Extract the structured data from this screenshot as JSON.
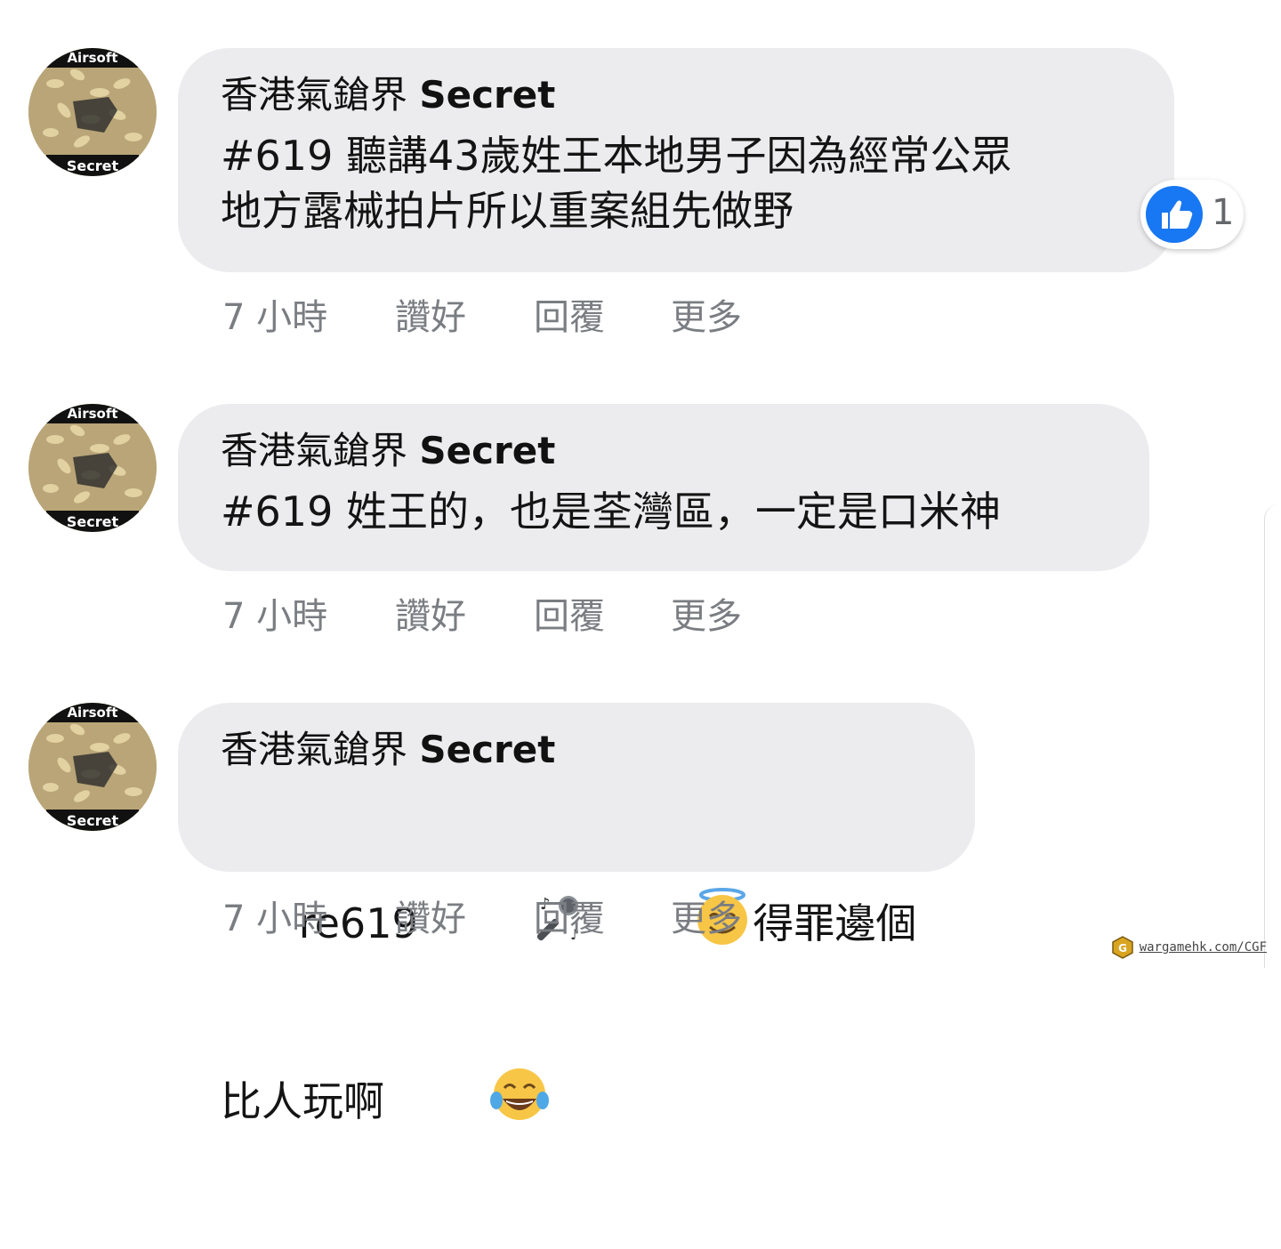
{
  "comments": [
    {
      "author_prefix": "香港氣鎗界",
      "author_bold": "Secret",
      "text": "#619 聽講43歲姓王本地男子因為經常公眾\n地方露械拍片所以重案組先做野",
      "time": "7 小時",
      "like": "讚好",
      "reply": "回覆",
      "more": "更多",
      "reaction_count": "1",
      "avatar_top_text": "Airsoft",
      "avatar_bottom_text": "Secret"
    },
    {
      "author_prefix": "香港氣鎗界",
      "author_bold": "Secret",
      "text": "#619 姓王的，也是荃灣區，一定是口米神",
      "time": "7 小時",
      "like": "讚好",
      "reply": "回覆",
      "more": "更多",
      "avatar_top_text": "Airsoft",
      "avatar_bottom_text": "Secret"
    },
    {
      "author_prefix": "香港氣鎗界",
      "author_bold": "Secret",
      "text_before": "re619 ",
      "text_middle": "得罪邊個比人玩啊",
      "time": "7 小時",
      "like": "讚好",
      "reply": "回覆",
      "more": "更多",
      "avatar_top_text": "Airsoft",
      "avatar_bottom_text": "Secret",
      "emojis": [
        "microphone-icon",
        "halo-smile-icon",
        "tears-of-joy-icon"
      ]
    }
  ],
  "watermark": "wargamehk.com/CGF"
}
